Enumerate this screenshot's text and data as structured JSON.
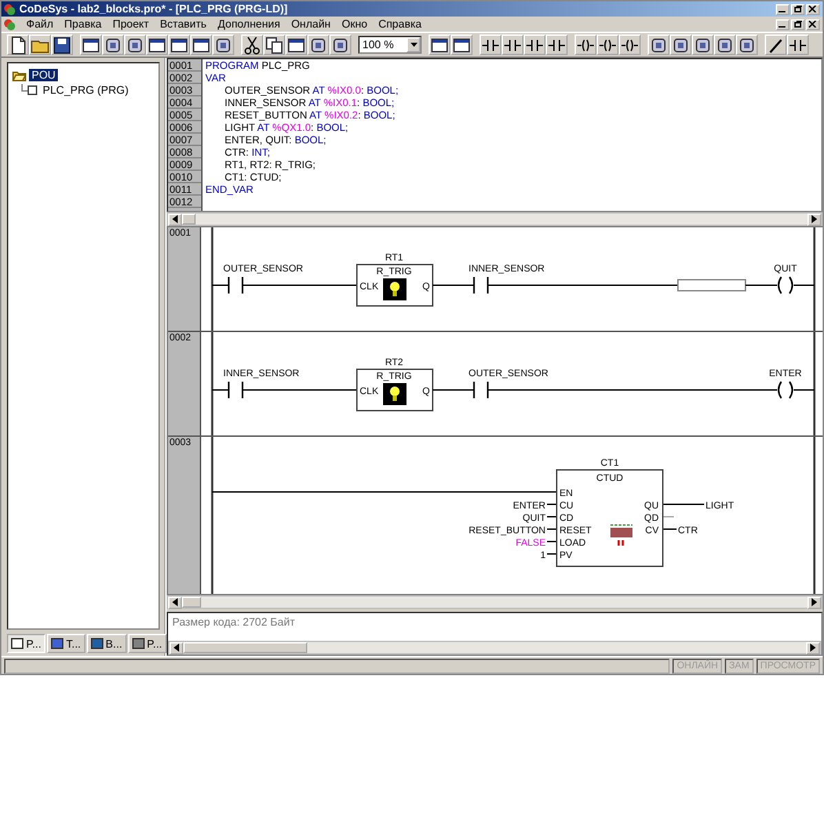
{
  "window": {
    "title": "CoDeSys - lab2_blocks.pro* - [PLC_PRG (PRG-LD)]"
  },
  "menu": [
    "Файл",
    "Правка",
    "Проект",
    "Вставить",
    "Дополнения",
    "Онлайн",
    "Окно",
    "Справка"
  ],
  "toolbar": {
    "zoom": "100 %"
  },
  "tree": [
    {
      "label": "POU",
      "expanded": true,
      "selected": true,
      "children": [
        {
          "label": "PLC_PRG (PRG)",
          "selected": false
        }
      ]
    }
  ],
  "object_tabs": [
    {
      "label": "P...",
      "selected": true
    },
    {
      "label": "T...",
      "selected": false
    },
    {
      "label": "B...",
      "selected": false
    },
    {
      "label": "P...",
      "selected": false
    }
  ],
  "declarations": [
    {
      "number": "0001",
      "tokens": [
        {
          "text": "PROGRAM",
          "kind": "keyword"
        },
        {
          "text": " PLC_PRG",
          "kind": "plain"
        }
      ]
    },
    {
      "number": "0002",
      "tokens": [
        {
          "text": "VAR",
          "kind": "keyword"
        }
      ]
    },
    {
      "number": "0003",
      "tokens": [
        {
          "text": "OUTER_SENSOR ",
          "kind": "plain"
        },
        {
          "text": "AT ",
          "kind": "keyword"
        },
        {
          "text": "%IX0.0",
          "kind": "address"
        },
        {
          "text": ": ",
          "kind": "plain"
        },
        {
          "text": "BOOL;",
          "kind": "keyword"
        }
      ]
    },
    {
      "number": "0004",
      "tokens": [
        {
          "text": "INNER_SENSOR ",
          "kind": "plain"
        },
        {
          "text": "AT ",
          "kind": "keyword"
        },
        {
          "text": "%IX0.1",
          "kind": "address"
        },
        {
          "text": ": ",
          "kind": "plain"
        },
        {
          "text": "BOOL;",
          "kind": "keyword"
        }
      ]
    },
    {
      "number": "0005",
      "tokens": [
        {
          "text": "RESET_BUTTON ",
          "kind": "plain"
        },
        {
          "text": "AT ",
          "kind": "keyword"
        },
        {
          "text": "%IX0.2",
          "kind": "address"
        },
        {
          "text": ": ",
          "kind": "plain"
        },
        {
          "text": "BOOL;",
          "kind": "keyword"
        }
      ]
    },
    {
      "number": "0006",
      "tokens": [
        {
          "text": "LIGHT ",
          "kind": "plain"
        },
        {
          "text": "AT ",
          "kind": "keyword"
        },
        {
          "text": "%QX1.0",
          "kind": "address"
        },
        {
          "text": ": ",
          "kind": "plain"
        },
        {
          "text": "BOOL;",
          "kind": "keyword"
        }
      ]
    },
    {
      "number": "0007",
      "tokens": [
        {
          "text": "ENTER, QUIT: ",
          "kind": "plain"
        },
        {
          "text": "BOOL;",
          "kind": "keyword"
        }
      ]
    },
    {
      "number": "0008",
      "tokens": [
        {
          "text": "CTR: ",
          "kind": "plain"
        },
        {
          "text": "INT;",
          "kind": "keyword"
        }
      ]
    },
    {
      "number": "0009",
      "tokens": [
        {
          "text": "RT1, RT2: R_TRIG;",
          "kind": "plain"
        }
      ]
    },
    {
      "number": "0010",
      "tokens": [
        {
          "text": "CT1: CTUD;",
          "kind": "plain"
        }
      ]
    },
    {
      "number": "0011",
      "tokens": [
        {
          "text": "END_VAR",
          "kind": "keyword"
        }
      ]
    },
    {
      "number": "0012"
    }
  ],
  "networks": [
    {
      "number": "0001",
      "elements": [
        {
          "kind": "contact",
          "label": "OUTER_SENSOR"
        },
        {
          "kind": "block",
          "instance": "RT1",
          "type": "R_TRIG",
          "inputs": [
            {
              "pin": "CLK"
            }
          ],
          "outputs": [
            {
              "pin": "Q"
            }
          ]
        },
        {
          "kind": "contact",
          "label": "INNER_SENSOR"
        },
        {
          "kind": "empty_box"
        },
        {
          "kind": "coil",
          "label": "QUIT"
        }
      ]
    },
    {
      "number": "0002",
      "elements": [
        {
          "kind": "contact",
          "label": "INNER_SENSOR"
        },
        {
          "kind": "block",
          "instance": "RT2",
          "type": "R_TRIG",
          "inputs": [
            {
              "pin": "CLK"
            }
          ],
          "outputs": [
            {
              "pin": "Q"
            }
          ]
        },
        {
          "kind": "contact",
          "label": "OUTER_SENSOR"
        },
        {
          "kind": "coil",
          "label": "ENTER"
        }
      ]
    },
    {
      "number": "0003",
      "elements": [
        {
          "kind": "block",
          "instance": "CT1",
          "type": "CTUD",
          "inputs": [
            {
              "pin": "EN"
            },
            {
              "pin": "CU",
              "signal": "ENTER",
              "kind": "variable"
            },
            {
              "pin": "CD",
              "signal": "QUIT",
              "kind": "variable"
            },
            {
              "pin": "RESET",
              "signal": "RESET_BUTTON",
              "kind": "variable"
            },
            {
              "pin": "LOAD",
              "signal": "FALSE",
              "kind": "boolean"
            },
            {
              "pin": "PV",
              "signal": "1",
              "kind": "number"
            }
          ],
          "outputs": [
            {
              "pin": "QU",
              "signal": "LIGHT"
            },
            {
              "pin": "QD"
            },
            {
              "pin": "CV",
              "signal": "CTR"
            }
          ]
        }
      ]
    }
  ],
  "messages": [
    "Размер кода: 2702 Байт"
  ],
  "status_bar": [
    {
      "label": "ОНЛАЙН",
      "active": false
    },
    {
      "label": "ЗАМ",
      "active": false
    },
    {
      "label": "ПРОСМОТР",
      "active": false
    }
  ]
}
